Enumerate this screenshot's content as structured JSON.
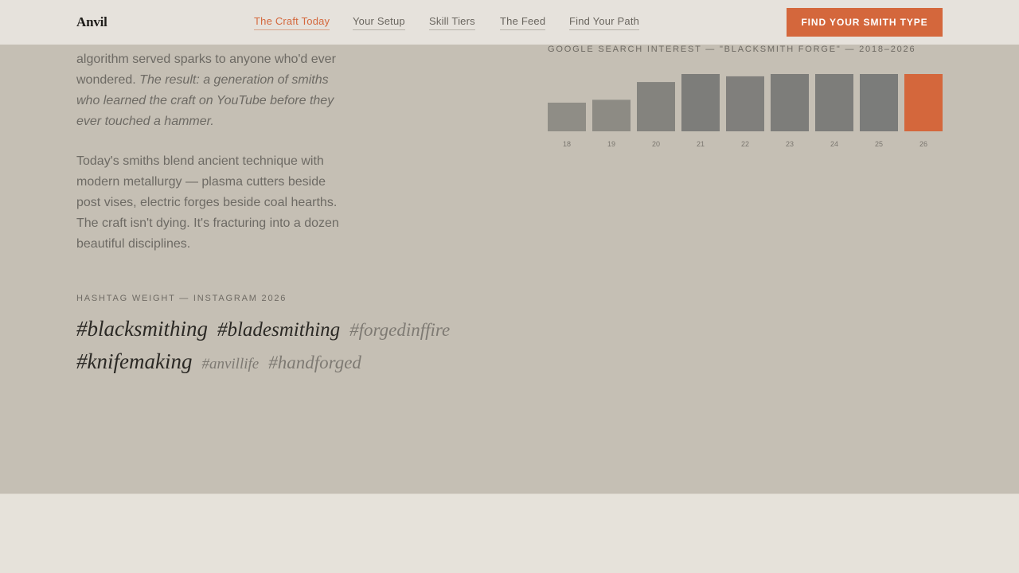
{
  "header": {
    "logo": "Anvil",
    "nav": [
      {
        "label": "The Craft Today",
        "active": true
      },
      {
        "label": "Your Setup",
        "active": false
      },
      {
        "label": "Skill Tiers",
        "active": false
      },
      {
        "label": "The Feed",
        "active": false
      },
      {
        "label": "Find Your Path",
        "active": false
      }
    ],
    "cta_label": "Find Your Smith Type"
  },
  "article": {
    "p1_line1": "algorithm served sparks to anyone who'd ever wondered.",
    "p1_italic": "The result: a generation of smiths who learned the craft on YouTube before they ever touched a hammer.",
    "p2": "Today's smiths blend ancient technique with modern metallurgy — plasma cutters beside post vises, electric forges beside coal hearths. The craft isn't dying. It's fracturing into a dozen beautiful disciplines."
  },
  "hashtags": {
    "label": "Hashtag Weight — Instagram 2026",
    "rows": [
      [
        {
          "text": "#blacksmithing",
          "weight": "dark",
          "size": 27
        },
        {
          "text": "#bladesmithing",
          "weight": "dark",
          "size": 25
        },
        {
          "text": "#forgedinffire",
          "weight": "light",
          "size": 23
        }
      ],
      [
        {
          "text": "#knifemaking",
          "weight": "dark",
          "size": 27
        },
        {
          "text": "#anvillife",
          "weight": "light",
          "size": 19
        },
        {
          "text": "#handforged",
          "weight": "light",
          "size": 23
        }
      ]
    ]
  },
  "chart_data": {
    "type": "bar",
    "title": "Google Search Interest — \"Blacksmith Forge\" — 2018–2026",
    "categories": [
      "18",
      "19",
      "20",
      "21",
      "22",
      "23",
      "24",
      "25",
      "26"
    ],
    "values": [
      50,
      55,
      86,
      100,
      96,
      100,
      100,
      100,
      100
    ],
    "ylim": [
      0,
      100
    ],
    "colors": [
      "#8f8d86",
      "#8d8b84",
      "#84837e",
      "#7d7d7a",
      "#807f7c",
      "#7d7d7a",
      "#7d7d7a",
      "#7b7c7a",
      "#d4673c"
    ],
    "highlight_color": "#d4673c"
  }
}
